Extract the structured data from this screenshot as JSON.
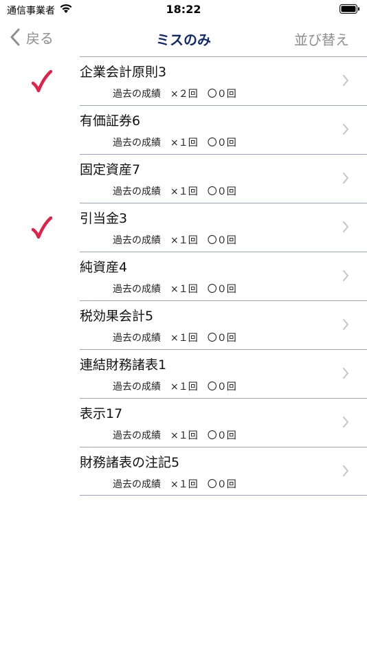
{
  "status_bar": {
    "carrier": "通信事業者",
    "time": "18:22"
  },
  "nav": {
    "back_label": "戻る",
    "title": "ミスのみ",
    "sort_label": "並び替え"
  },
  "colors": {
    "title_navy": "#102a6b",
    "check_red": "#e0224a",
    "gray": "#8e8e93"
  },
  "list": {
    "items": [
      {
        "title": "企業会計原則3",
        "history_label": "過去の成績",
        "wrong": "×２回",
        "right": "〇０回",
        "checked": true
      },
      {
        "title": "有価証券6",
        "history_label": "過去の成績",
        "wrong": "×１回",
        "right": "〇０回",
        "checked": false
      },
      {
        "title": "固定資産7",
        "history_label": "過去の成績",
        "wrong": "×１回",
        "right": "〇０回",
        "checked": false
      },
      {
        "title": "引当金3",
        "history_label": "過去の成績",
        "wrong": "×１回",
        "right": "〇０回",
        "checked": true
      },
      {
        "title": "純資産4",
        "history_label": "過去の成績",
        "wrong": "×１回",
        "right": "〇０回",
        "checked": false
      },
      {
        "title": "税効果会計5",
        "history_label": "過去の成績",
        "wrong": "×１回",
        "right": "〇０回",
        "checked": false
      },
      {
        "title": "連結財務諸表1",
        "history_label": "過去の成績",
        "wrong": "×１回",
        "right": "〇０回",
        "checked": false
      },
      {
        "title": "表示17",
        "history_label": "過去の成績",
        "wrong": "×１回",
        "right": "〇０回",
        "checked": false
      },
      {
        "title": "財務諸表の注記5",
        "history_label": "過去の成績",
        "wrong": "×１回",
        "right": "〇０回",
        "checked": false
      }
    ]
  }
}
